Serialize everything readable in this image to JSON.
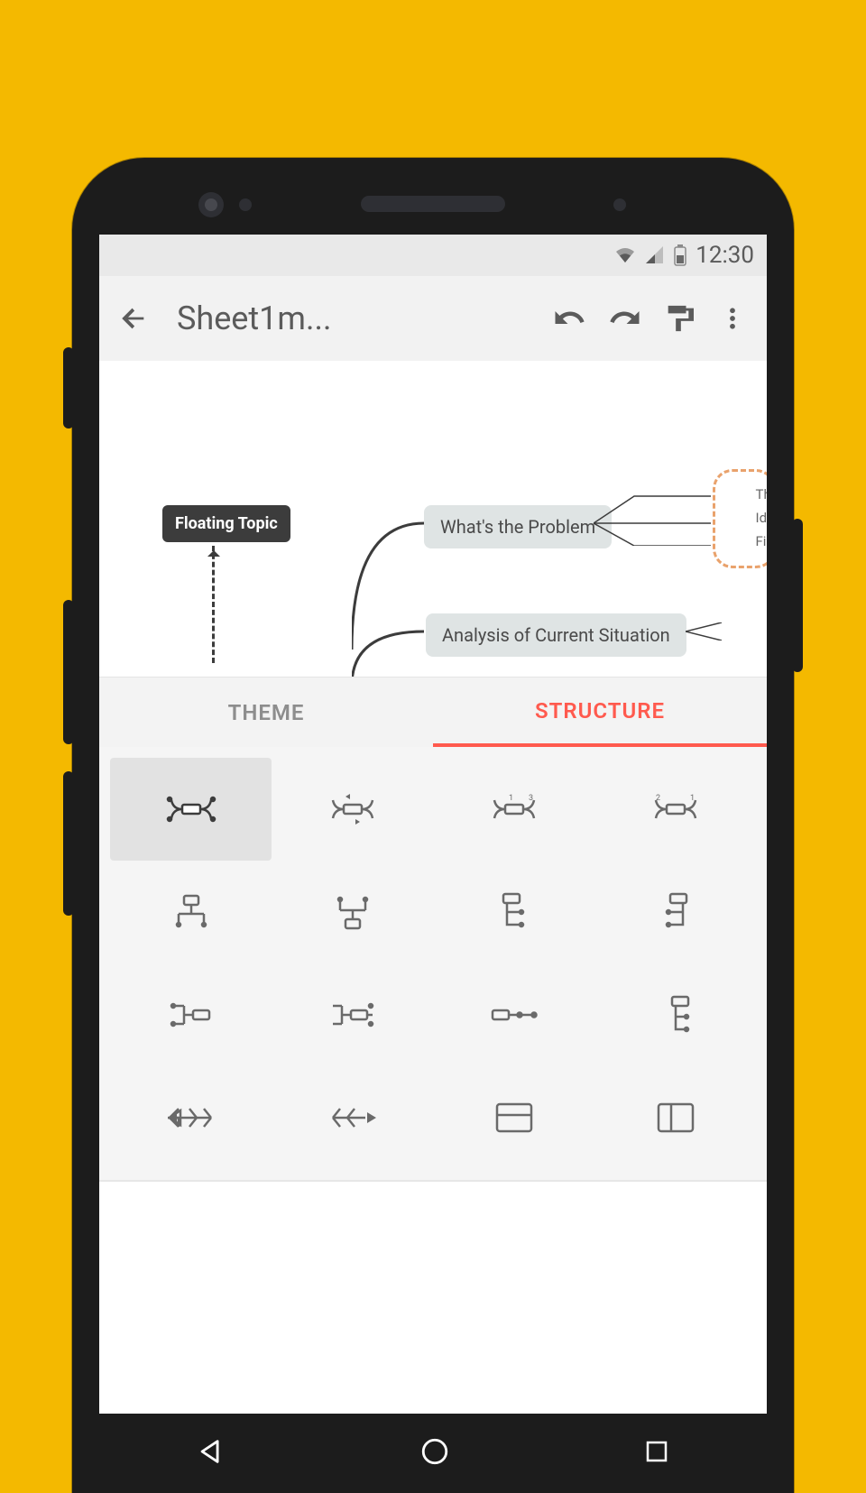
{
  "status_bar": {
    "time": "12:30"
  },
  "app_bar": {
    "title": "Sheet1m...",
    "icons": [
      "back",
      "undo",
      "redo",
      "format-paint",
      "more-vert"
    ]
  },
  "canvas": {
    "floating_topic_label": "Floating Topic",
    "node1": "What's the Problem",
    "node2": "Analysis of Current Situation",
    "clip_lines": [
      "Th",
      "Ide",
      "Fir"
    ]
  },
  "tabs": {
    "theme_label": "THEME",
    "structure_label": "STRUCTURE",
    "active": "structure"
  },
  "structure_grid": {
    "options": [
      "map",
      "clockwise",
      "anticlockwise",
      "balanced",
      "org-down",
      "org-up",
      "logic-right",
      "logic-left",
      "tree-right",
      "tree-left",
      "timeline",
      "tree-down",
      "fishbone-left",
      "fishbone-right",
      "spreadsheet",
      "matrix"
    ],
    "selected_index": 0
  },
  "nav_bar": {
    "buttons": [
      "back",
      "home",
      "recent"
    ]
  }
}
